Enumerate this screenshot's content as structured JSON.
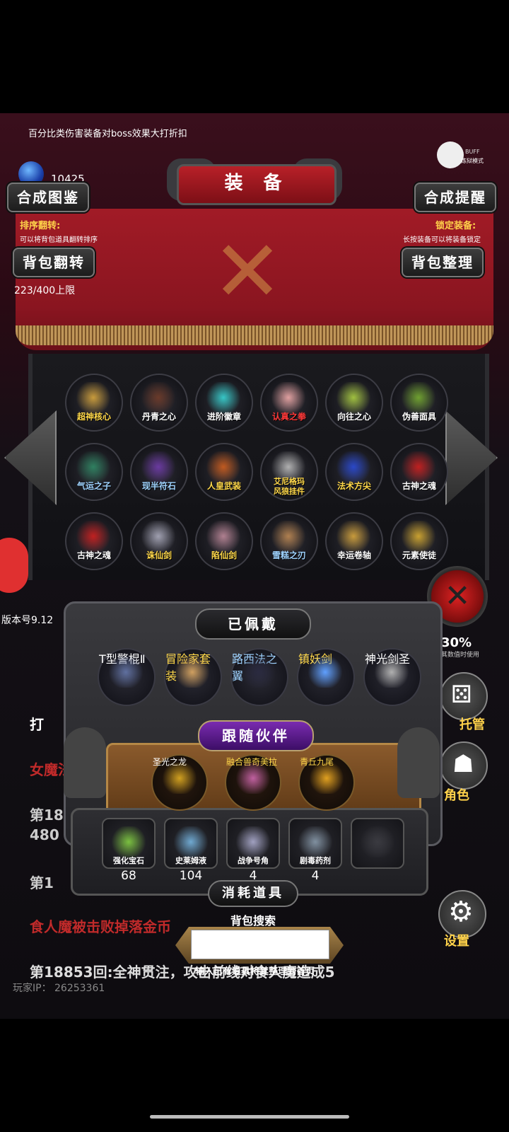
{
  "tip": "百分比类伤害装备对boss效果大打折扣",
  "gems": {
    "value": "10425"
  },
  "buff": {
    "line1": "BUFF",
    "line2": "炼狱模式"
  },
  "title": "装 备",
  "buttons": {
    "synth_book": "合成图鉴",
    "synth_remind": "合成提醒",
    "bag_flip": "背包翻转",
    "bag_sort": "背包整理"
  },
  "notes": {
    "sort_flip_label": "排序翻转:",
    "sort_flip_desc": "可以将背包道具翻转排序",
    "lock_label": "锁定装备:",
    "lock_desc": "长按装备可以将装备锁定"
  },
  "capacity": "223/400上限",
  "grid": [
    [
      {
        "name": "超神核心",
        "tone": "gold",
        "color": "#c89b3c"
      },
      {
        "name": "丹青之心",
        "tone": "white",
        "color": "#6a3a2a"
      },
      {
        "name": "进阶徽章",
        "tone": "white",
        "color": "#37c6c6"
      },
      {
        "name": "认真之拳",
        "tone": "red",
        "color": "#e0a0a0"
      },
      {
        "name": "向往之心",
        "tone": "white",
        "color": "#a0c040"
      },
      {
        "name": "伪善面具",
        "tone": "white",
        "color": "#6fa030"
      }
    ],
    [
      {
        "name": "气运之子",
        "tone": "blue",
        "color": "#2f8060"
      },
      {
        "name": "现半符石",
        "tone": "blue",
        "color": "#6a3aa0"
      },
      {
        "name": "人皇武装",
        "tone": "gold",
        "color": "#c05a20"
      },
      {
        "name": "艾尼格玛\n风狼挂件",
        "tone": "gold",
        "color": "#b0b0b0"
      },
      {
        "name": "法术方尖",
        "tone": "gold",
        "color": "#2a48c8"
      },
      {
        "name": "古神之魂",
        "tone": "white",
        "color": "#c02020"
      }
    ],
    [
      {
        "name": "古神之魂",
        "tone": "white",
        "color": "#c02020"
      },
      {
        "name": "诛仙剑",
        "tone": "gold",
        "color": "#a0a0b0"
      },
      {
        "name": "陷仙剑",
        "tone": "gold",
        "color": "#b08090"
      },
      {
        "name": "雪糕之刃",
        "tone": "blue",
        "color": "#b08050"
      },
      {
        "name": "幸运卷轴",
        "tone": "white",
        "color": "#c89b3c"
      },
      {
        "name": "元素使徒",
        "tone": "white",
        "color": "#c8a030"
      }
    ]
  ],
  "version": "版本号9.12",
  "equipped": {
    "header": "已佩戴",
    "items": [
      {
        "name": "T型警棍Ⅱ",
        "tone": "white",
        "color": "#6070a0"
      },
      {
        "name": "冒险家套装",
        "tone": "gold",
        "color": "#d0a060"
      },
      {
        "name": "路西法之翼",
        "tone": "blue",
        "color": "#2a2a40"
      },
      {
        "name": "镇妖剑",
        "tone": "gold",
        "color": "#60a0ff"
      },
      {
        "name": "神光剑圣",
        "tone": "white",
        "color": "#b0b0b0"
      }
    ]
  },
  "companions": {
    "header": "跟随伙伴",
    "items": [
      {
        "name": "圣光之龙",
        "tone": "white",
        "color": "#d0a020"
      },
      {
        "name": "融合兽奇美拉",
        "tone": "gold",
        "color": "#c060a0"
      },
      {
        "name": "青丘九尾",
        "tone": "gold",
        "color": "#e0a020"
      }
    ]
  },
  "consumables": {
    "header": "消耗道具",
    "items": [
      {
        "name": "强化宝石",
        "count": "68",
        "color": "#7ac040"
      },
      {
        "name": "史莱姆液",
        "count": "104",
        "color": "#6fa8d0"
      },
      {
        "name": "战争号角",
        "count": "4",
        "color": "#a0a0c0"
      },
      {
        "name": "剧毒药剂",
        "count": "4",
        "color": "#8090a0"
      },
      {
        "name": "",
        "count": "",
        "color": "#3a3a40"
      }
    ]
  },
  "search": {
    "label": "背包搜索",
    "hint": "输入已有道具将其整理到首页"
  },
  "right_side": {
    "stat_value": "30%",
    "stat_desc": "其数值时使用",
    "btn1_label": "托管",
    "btn2_label": "角色",
    "btn3_label": "设置"
  },
  "log": {
    "line1": "打",
    "line2": "女魔法",
    "line3": "第18",
    "line3b": "480",
    "line4": "第1",
    "line5": "食人魔被击败掉落金币",
    "line6": "第18853回:全神贯注，攻击前线对食人魔造成5"
  },
  "player_ip": "玩家IP： 26253361",
  "colors": {
    "gold": "#ffd24a",
    "red_banner": "#a11b26",
    "purple": "#7a2bb0"
  }
}
